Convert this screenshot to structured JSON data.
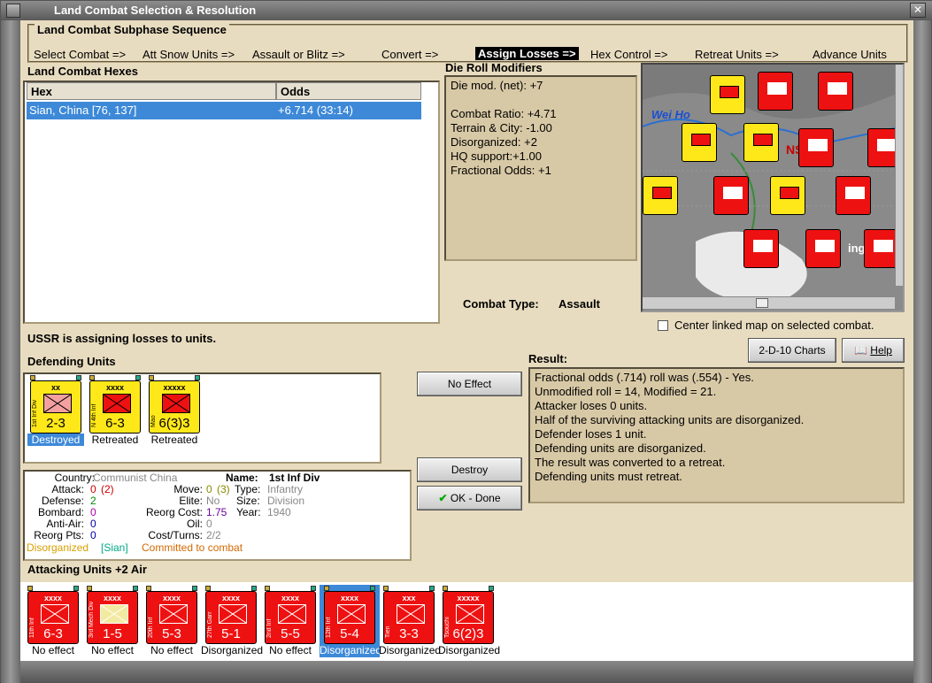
{
  "window": {
    "title": "Land Combat Selection & Resolution",
    "close": "✕"
  },
  "subphase": {
    "legend": "Land Combat Subphase Sequence",
    "steps": [
      "Select Combat =>",
      "Att Snow Units =>",
      "Assault or Blitz =>",
      "Convert =>",
      "Assign Losses =>",
      "Hex Control =>",
      "Retreat Units =>",
      "Advance Units"
    ],
    "active_index": 4
  },
  "hexes": {
    "title": "Land Combat Hexes",
    "col_hex": "Hex",
    "col_odds": "Odds",
    "rows": [
      {
        "hex": "Sian, China [76, 137]",
        "odds": "+6.714 (33:14)"
      }
    ]
  },
  "die_roll": {
    "title": "Die Roll Modifiers",
    "lines": [
      "Die mod. (net): +7",
      "",
      "Combat Ratio: +4.71",
      "Terrain & City: -1.00",
      "Disorganized: +2",
      "HQ support:+1.00",
      "Fractional Odds: +1"
    ]
  },
  "combat_type": {
    "label": "Combat Type:",
    "value": "Assault"
  },
  "center_map": {
    "label": "Center linked map on selected combat.",
    "checked": false
  },
  "status": "USSR is assigning losses to units.",
  "buttons": {
    "charts": "2-D-10 Charts",
    "help": "Help",
    "no_effect": "No Effect",
    "destroy": "Destroy",
    "ok_done": "OK - Done"
  },
  "map": {
    "label_weiho": "Wei Ho",
    "label_ns": "NS",
    "label_ing": "ing"
  },
  "defending": {
    "title": "Defending Units",
    "units": [
      {
        "size": "xx",
        "name": "1st Inf Div",
        "strength": "2-3",
        "color": "#ffe81a",
        "status": "Destroyed",
        "selected": true
      },
      {
        "size": "xxxx",
        "name": "N 4th Inf",
        "strength": "6-3",
        "color": "#ffe81a",
        "status": "Retreated",
        "selected": false
      },
      {
        "size": "xxxxx",
        "name": "Mao",
        "strength": "6(3)3",
        "color": "#ffe81a",
        "status": "Retreated",
        "selected": false
      }
    ]
  },
  "details": {
    "country_label": "Country:",
    "country": "Communist China",
    "name_label": "Name:",
    "name": "1st Inf Div",
    "attack_label": "Attack:",
    "attack": "0",
    "attack_extra": "(2)",
    "move_label": "Move:",
    "move": "0",
    "move_extra": "(3)",
    "type_label": "Type:",
    "type": "Infantry",
    "defense_label": "Defense:",
    "defense": "2",
    "elite_label": "Elite:",
    "elite": "No",
    "size_label": "Size:",
    "size": "Division",
    "bombard_label": "Bombard:",
    "bombard": "0",
    "reorg_cost_label": "Reorg Cost:",
    "reorg_cost": "1.75",
    "year_label": "Year:",
    "year": "1940",
    "antiair_label": "Anti-Air:",
    "antiair": "0",
    "oil_label": "Oil:",
    "oil": "0",
    "reorg_pts_label": "Reorg Pts:",
    "reorg_pts": "0",
    "cost_turns_label": "Cost/Turns:",
    "cost_turns": "2/2",
    "status_disorganized": "Disorganized",
    "status_sian": "[Sian]",
    "status_committed": "Committed to combat"
  },
  "result": {
    "title": "Result:",
    "lines": [
      "Fractional odds (.714) roll was (.554)  - Yes.",
      "Unmodified roll = 14, Modified = 21.",
      "Attacker loses 0 units.",
      "Half of the surviving attacking units are disorganized.",
      "Defender loses 1 unit.",
      "Defending units are disorganized.",
      "The result was converted to a retreat.",
      "Defending units must retreat."
    ]
  },
  "attacking": {
    "title": "Attacking Units +2 Air",
    "units": [
      {
        "size": "xxxx",
        "name": "11th Inf",
        "strength": "6-3",
        "status": "No effect",
        "selected": false
      },
      {
        "size": "xxxx",
        "name": "3rd Mech Div",
        "strength": "1-5",
        "status": "No effect",
        "selected": false
      },
      {
        "size": "xxxx",
        "name": "20th Inf",
        "strength": "5-3",
        "status": "No effect",
        "selected": false
      },
      {
        "size": "xxxx",
        "name": "27th Garr",
        "strength": "5-1",
        "status": "Disorganized",
        "selected": false
      },
      {
        "size": "xxxx",
        "name": "2nd Inf",
        "strength": "5-5",
        "status": "No effect",
        "selected": false
      },
      {
        "size": "xxxx",
        "name": "12th Inf",
        "strength": "5-4",
        "status": "Disorganized",
        "selected": true
      },
      {
        "size": "xxx",
        "name": "Tien",
        "strength": "3-3",
        "status": "Disorganized",
        "selected": false
      },
      {
        "size": "xxxxx",
        "name": "Tsouchi",
        "strength": "6(2)3",
        "status": "Disorganized",
        "selected": false
      }
    ]
  },
  "colors": {
    "accent": "#3d89d8",
    "unit_red": "#e11",
    "unit_yellow": "#ffe81a",
    "panel": "#d8c9a6"
  }
}
